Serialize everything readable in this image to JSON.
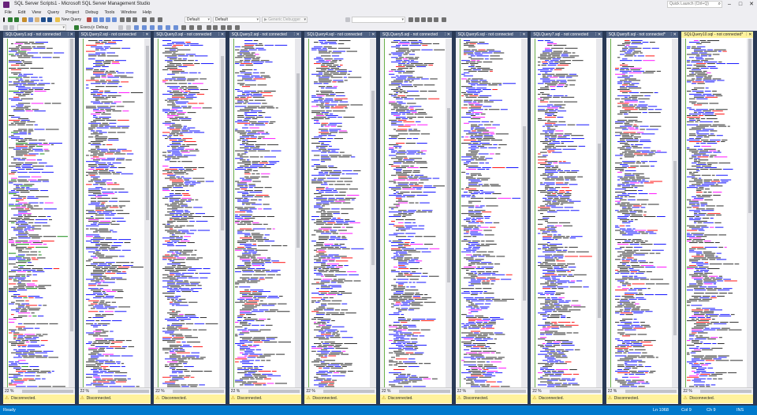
{
  "window": {
    "title": "SQL Server Scripts1 - Microsoft SQL Server Management Studio",
    "quick_launch_placeholder": "Quick Launch (Ctrl+Q)",
    "icons": {
      "app": "ssms-icon",
      "minimize": "minimize-icon",
      "maximize": "maximize-icon",
      "close": "close-icon",
      "search": "search-icon"
    }
  },
  "menu": [
    "File",
    "Edit",
    "View",
    "Query",
    "Project",
    "Debug",
    "Tools",
    "Window",
    "Help"
  ],
  "toolbar": {
    "new_query_label": "New Query",
    "config_value_1": "Default",
    "config_value_2": "Default",
    "debugger_label": "Generic Debugger",
    "execute_label": "Execute",
    "debug_label": "Debug"
  },
  "tabs": [
    {
      "label": "SQLQuery1.sql - not connected",
      "active": false
    },
    {
      "label": "SQLQuery2.sql - not connected",
      "active": false
    },
    {
      "label": "SQLQuery3.sql - not connected",
      "active": false
    },
    {
      "label": "SQLQuery2.sql - not connected",
      "active": false
    },
    {
      "label": "SQLQuery4.sql - not connected",
      "active": false
    },
    {
      "label": "SQLQuery5.sql - not connected",
      "active": false
    },
    {
      "label": "SQLQuery6.sql - not connected",
      "active": false
    },
    {
      "label": "SQLQuery7.sql - not connected",
      "active": false
    },
    {
      "label": "SQLQuery8.sql - not connected*",
      "active": false
    },
    {
      "label": "SQLQuery10.sql - not connected*",
      "active": true
    }
  ],
  "pane_footer": {
    "zoom": "22 %",
    "connection_status": "Disconnected."
  },
  "statusbar": {
    "ready": "Ready",
    "line": "Ln 1068",
    "col": "Col 9",
    "ch": "Ch 9",
    "mode": "INS"
  },
  "colors": {
    "status_bar": "#007acc",
    "doc_well": "#293955",
    "tab_inactive": "#4d6082",
    "tab_active": "#fff29d",
    "connection_bar": "#fff29d",
    "sql_keyword": "#0000ff",
    "sql_string": "#ff0000",
    "sql_comment": "#008000",
    "sql_function": "#ff00ff",
    "change_marker": "#6ab04c"
  }
}
